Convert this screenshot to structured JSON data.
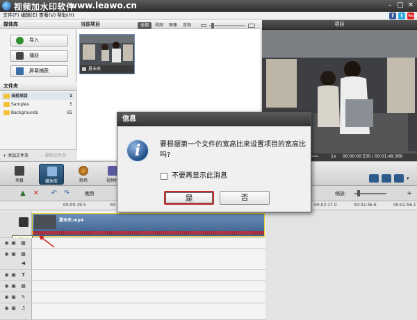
{
  "titlebar": {
    "title": "视频加水印软件",
    "site": "www.leawo.cn"
  },
  "menu": [
    "文件(F)",
    "编辑(E)",
    "查看(V)",
    "帮助(H)"
  ],
  "social": {
    "facebook": "f",
    "twitter": "t",
    "youtube": "You"
  },
  "library": {
    "header": "媒体库",
    "buttons": [
      "导入",
      "捕获",
      "屏幕捕获"
    ],
    "folders_header": "文件夹",
    "folders": [
      {
        "name": "当前项目",
        "count": "1"
      },
      {
        "name": "Samples",
        "count": "5"
      },
      {
        "name": "Backgrounds",
        "count": "65"
      }
    ],
    "add_folder": "添加文件夹",
    "delete_folder": "删除文件夹"
  },
  "project": {
    "header": "当前项目",
    "filters": [
      "全部",
      "视频",
      "图像",
      "音频"
    ],
    "clip_name": "夏末央"
  },
  "preview": {
    "header": "项目",
    "speed": "1x",
    "time": "00:00:00.530 / 00:01:49.360"
  },
  "main_tabs": [
    "项目",
    "媒体库",
    "转场",
    "视频特"
  ],
  "edit_toolbar": {
    "cut": "裁剪",
    "zoom_label": "缩放:"
  },
  "ruler": [
    "00:00:19.5",
    "00:00:39.0",
    "00:02:17.0",
    "00:02:36.6",
    "00:02:56.1"
  ],
  "timeline": {
    "clip_name": "夏末央.mp4",
    "tooltip": "主视频轨"
  },
  "dialog": {
    "title": "信息",
    "message": "要根据第一个文件的宽高比来设置项目的宽高比吗?",
    "checkbox": "不要再显示此消息",
    "yes": "是",
    "no": "否"
  }
}
